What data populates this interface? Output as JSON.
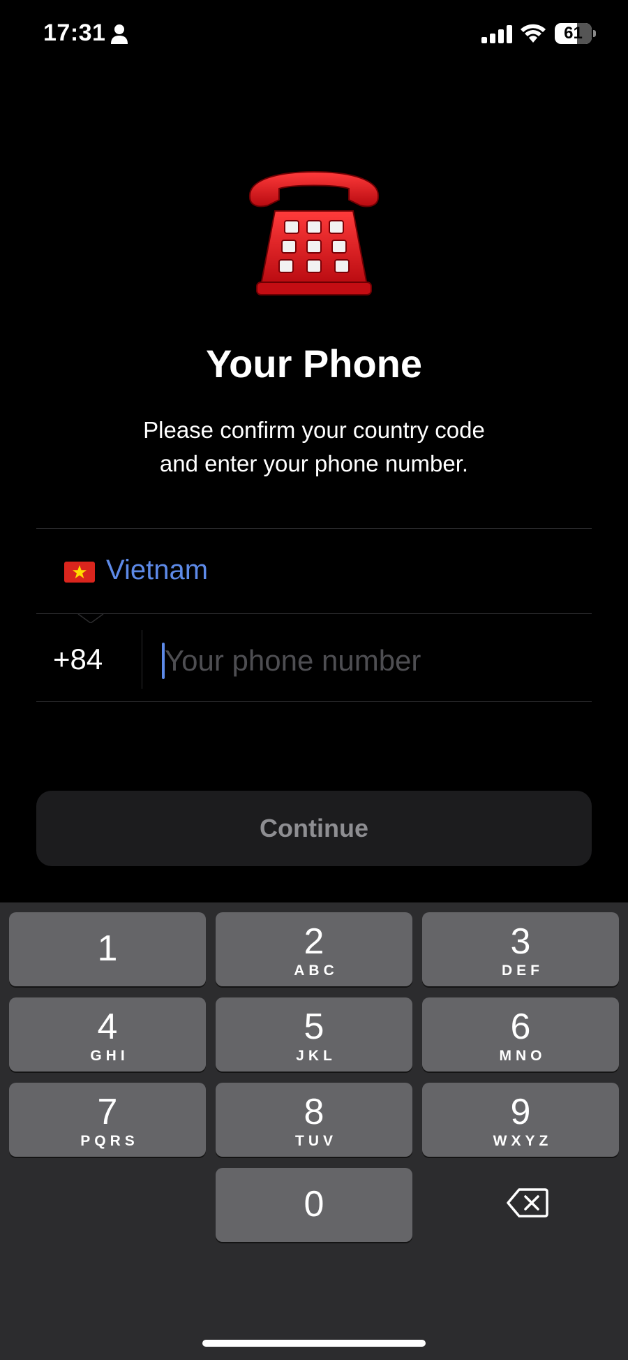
{
  "status_bar": {
    "time": "17:31",
    "battery_level": "61",
    "icons": [
      "person-icon",
      "signal-icon",
      "wifi-icon",
      "battery-icon"
    ]
  },
  "header": {
    "icon": "telephone-icon",
    "title": "Your Phone",
    "subtitle_line1": "Please confirm your country code",
    "subtitle_line2": "and enter your phone number."
  },
  "form": {
    "country_flag": "vietnam-flag-icon",
    "country_name": "Vietnam",
    "country_code": "+84",
    "phone_value": "",
    "phone_placeholder": "Your phone number",
    "continue_label": "Continue"
  },
  "keypad": {
    "keys": [
      {
        "digit": "1",
        "letters": ""
      },
      {
        "digit": "2",
        "letters": "ABC"
      },
      {
        "digit": "3",
        "letters": "DEF"
      },
      {
        "digit": "4",
        "letters": "GHI"
      },
      {
        "digit": "5",
        "letters": "JKL"
      },
      {
        "digit": "6",
        "letters": "MNO"
      },
      {
        "digit": "7",
        "letters": "PQRS"
      },
      {
        "digit": "8",
        "letters": "TUV"
      },
      {
        "digit": "9",
        "letters": "WXYZ"
      },
      {
        "digit": "0",
        "letters": ""
      }
    ],
    "delete_icon": "backspace-icon"
  },
  "colors": {
    "background": "#000000",
    "accent": "#5d8ae8",
    "keypad_background": "#2c2c2e",
    "key_background": "#656568",
    "button_background": "#1c1c1e",
    "phone_red": "#e0141b"
  }
}
